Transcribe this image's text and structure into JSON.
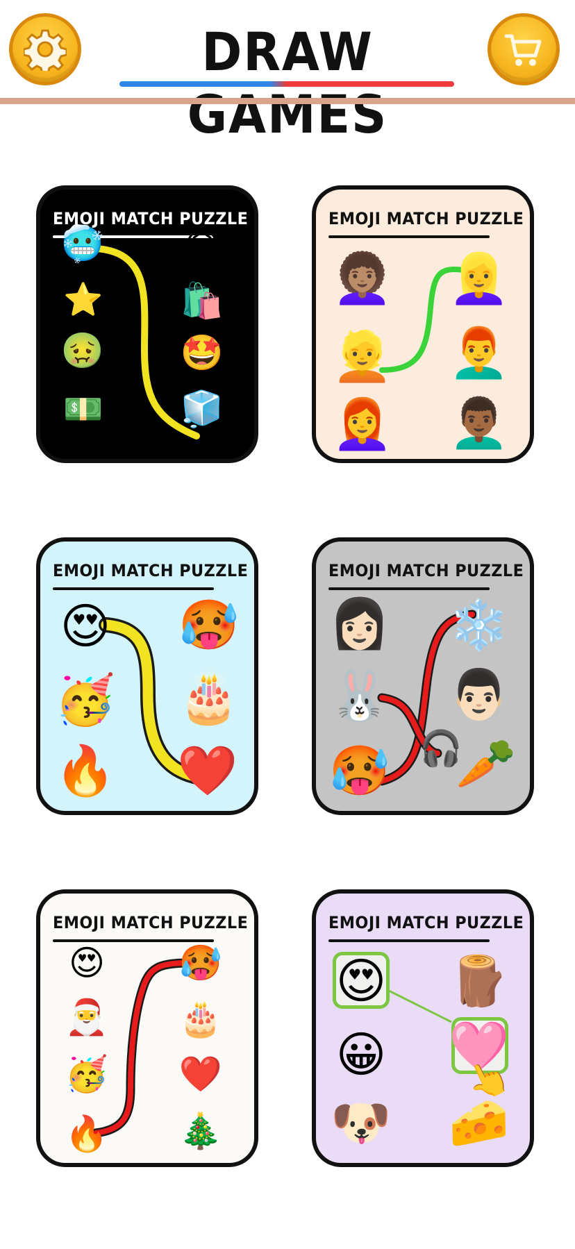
{
  "header": {
    "title": "DRAW GAMES",
    "settings_icon": "gear-icon",
    "shop_icon": "cart-icon",
    "accent_color": "#f7b51f"
  },
  "cards": [
    {
      "title": "EMOJI MATCH PUZZLE",
      "background": "#000000",
      "title_color": "#ffffff",
      "line_color": "#f2e322",
      "emojis": [
        "🥶",
        "⭐",
        "🤢",
        "💵",
        "😷",
        "🛍️",
        "🤩",
        "🧊"
      ]
    },
    {
      "title": "EMOJI MATCH PUZZLE",
      "background": "#fcecde",
      "title_color": "#111111",
      "line_color": "#3ad43a",
      "emojis": [
        "👩🏽‍🦱",
        "👱",
        "👩‍🦰",
        "👱‍♀️",
        "👨‍🦰",
        "👨🏾‍🦱"
      ]
    },
    {
      "title": "EMOJI MATCH PUZZLE",
      "background": "#d4f4fc",
      "title_color": "#111111",
      "line_color": "#f2e322",
      "emojis": [
        "😍",
        "🥳",
        "🔥",
        "🥵",
        "🎂",
        "❤️"
      ]
    },
    {
      "title": "EMOJI MATCH PUZZLE",
      "background": "#c4c4c4",
      "title_color": "#111111",
      "line_color": "#e61c1c",
      "emojis": [
        "👩🏻",
        "🐰",
        "🥵",
        "❄️",
        "👨🏻",
        "🎧",
        "🥕"
      ]
    },
    {
      "title": "EMOJI MATCH PUZZLE",
      "background": "#fbfaf6",
      "title_color": "#111111",
      "line_color": "#e61c1c",
      "emojis": [
        "😍",
        "🎅",
        "🥳",
        "🔥",
        "🥵",
        "🎂",
        "❤️",
        "🎄"
      ]
    },
    {
      "title": "EMOJI MATCH PUZZLE",
      "background": "#eadcf6",
      "title_color": "#111111",
      "line_color": "#7dc642",
      "emojis": [
        "😍",
        "😀",
        "🐶",
        "🪵",
        "🩷",
        "👆",
        "🧀"
      ]
    }
  ]
}
